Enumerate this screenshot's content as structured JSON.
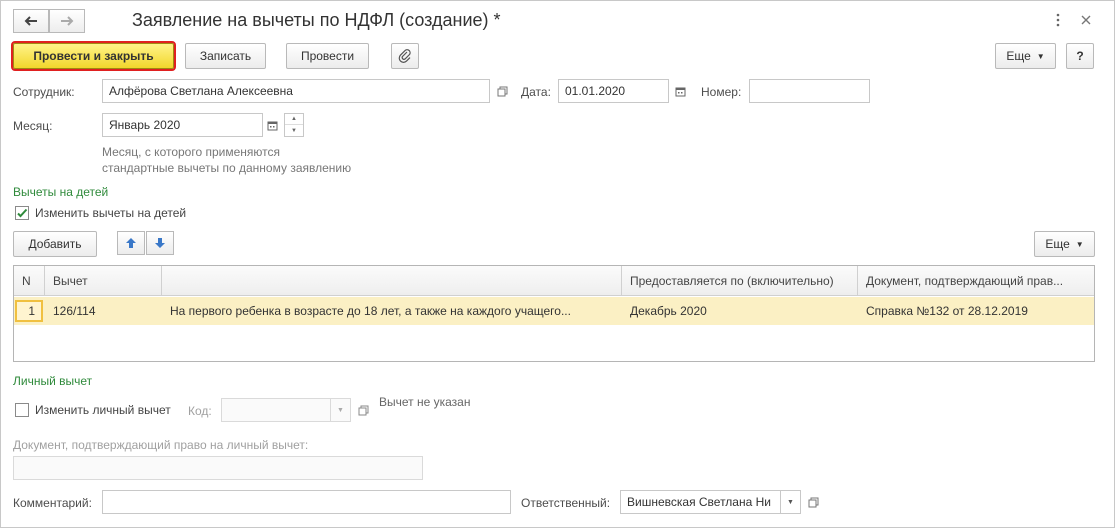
{
  "window": {
    "title": "Заявление на вычеты по НДФЛ (создание) *"
  },
  "toolbar": {
    "post_close_label": "Провести и закрыть",
    "save_label": "Записать",
    "post_label": "Провести",
    "more_label": "Еще",
    "help_label": "?"
  },
  "form": {
    "employee_label": "Сотрудник:",
    "employee_value": "Алфёрова Светлана Алексеевна",
    "date_label": "Дата:",
    "date_value": "01.01.2020",
    "number_label": "Номер:",
    "number_value": "",
    "month_label": "Месяц:",
    "month_value": "Январь 2020",
    "month_hint_line1": "Месяц, с которого применяются",
    "month_hint_line2": "стандартные вычеты по данному заявлению"
  },
  "children": {
    "section_title": "Вычеты на детей",
    "change_checkbox_label": "Изменить вычеты на детей",
    "change_checked": true,
    "add_label": "Добавить",
    "more_label": "Еще",
    "columns": [
      "N",
      "Вычет",
      "",
      "Предоставляется по (включительно)",
      "Документ, подтверждающий прав..."
    ],
    "rows": [
      {
        "n": "1",
        "code": "126/114",
        "description": "На первого ребенка в возрасте до 18 лет, а также на каждого учащего...",
        "until": "Декабрь 2020",
        "document": "Справка №132 от 28.12.2019"
      }
    ]
  },
  "personal": {
    "section_title": "Личный вычет",
    "change_checkbox_label": "Изменить личный вычет",
    "change_checked": false,
    "code_label": "Код:",
    "code_value": "",
    "not_specified": "Вычет не указан",
    "document_label": "Документ, подтверждающий право на личный вычет:",
    "document_value": ""
  },
  "footer": {
    "comment_label": "Комментарий:",
    "comment_value": "",
    "responsible_label": "Ответственный:",
    "responsible_value": "Вишневская Светлана Ни"
  },
  "colors": {
    "primary_button": "#f2d72b",
    "primary_outline": "#e02020",
    "section_title": "#2f8a3b",
    "selected_row": "#fbf0c4"
  }
}
